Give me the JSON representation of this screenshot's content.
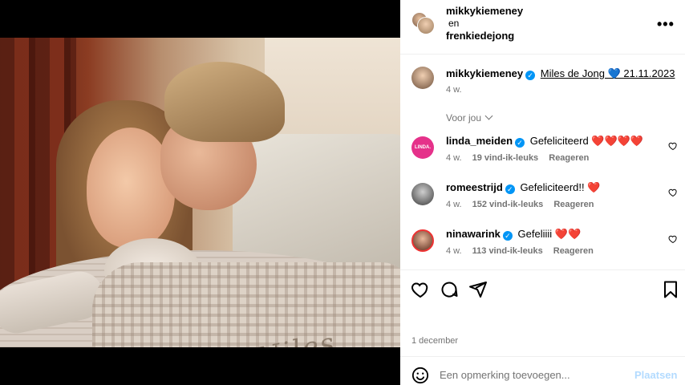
{
  "header": {
    "user1": "mikkykiemeney",
    "and": "en",
    "user2": "frenkiedejong",
    "more": "•••"
  },
  "caption": {
    "username": "mikkykiemeney",
    "text": "Miles de Jong 💙 21.11.2023",
    "time": "4 w."
  },
  "voor_jou": "Voor jou",
  "comments": [
    {
      "username": "linda_meiden",
      "text": "Gefeliciteerd ❤️❤️❤️❤️",
      "time": "4 w.",
      "likes": "19 vind-ik-leuks",
      "reply": "Reageren",
      "avatar_label": "LINDA."
    },
    {
      "username": "romeestrijd",
      "text": "Gefeliciteerd!! ❤️",
      "time": "4 w.",
      "likes": "152 vind-ik-leuks",
      "reply": "Reageren"
    },
    {
      "username": "ninawarink",
      "text": "Gefeliiii ❤️❤️",
      "time": "4 w.",
      "likes": "113 vind-ik-leuks",
      "reply": "Reageren"
    }
  ],
  "date": "1 december",
  "comment_box": {
    "placeholder": "Een opmerking toevoegen...",
    "post_label": "Plaatsen"
  },
  "photo": {
    "embroidery": "Niles"
  },
  "colors": {
    "verified": "#0095f6",
    "post_disabled": "#b3dbff",
    "muted": "#737373"
  }
}
